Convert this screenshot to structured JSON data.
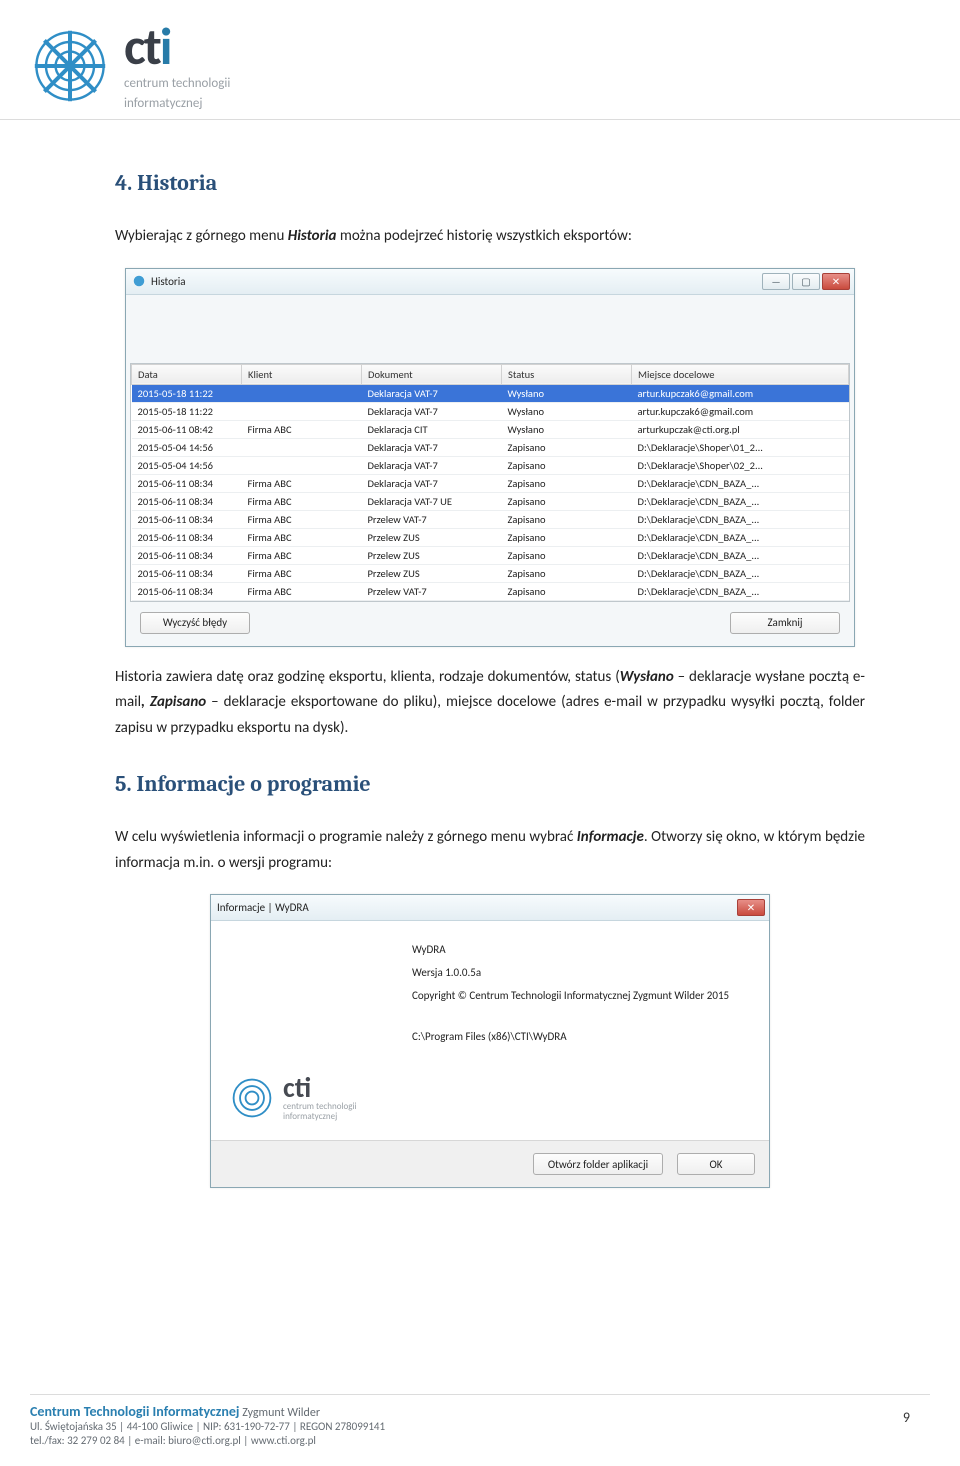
{
  "header": {
    "logo_sub1": "centrum technologii",
    "logo_sub2": "informatycznej"
  },
  "section1": {
    "title": "4. Historia",
    "intro_pre": "Wybierając z górnego menu ",
    "intro_em": "Historia",
    "intro_post": " można podejrzeć historię wszystkich eksportów:"
  },
  "historia_window": {
    "title": "Historia",
    "columns": [
      "Data",
      "Klient",
      "Dokument",
      "Status",
      "Miejsce docelowe"
    ],
    "rows": [
      {
        "data": "2015-05-18 11:22",
        "klient": "",
        "dokument": "Deklaracja VAT-7",
        "status": "Wysłano",
        "miejsce": "artur.kupczak6@gmail.com",
        "selected": true
      },
      {
        "data": "2015-05-18 11:22",
        "klient": "",
        "dokument": "Deklaracja VAT-7",
        "status": "Wysłano",
        "miejsce": "artur.kupczak6@gmail.com"
      },
      {
        "data": "2015-06-11 08:42",
        "klient": "Firma ABC",
        "dokument": "Deklaracja CIT",
        "status": "Wysłano",
        "miejsce": "arturkupczak@cti.org.pl"
      },
      {
        "data": "2015-05-04 14:56",
        "klient": "",
        "dokument": "Deklaracja VAT-7",
        "status": "Zapisano",
        "miejsce": "D:\\Deklaracje\\Shoper\\01_2..."
      },
      {
        "data": "2015-05-04 14:56",
        "klient": "",
        "dokument": "Deklaracja VAT-7",
        "status": "Zapisano",
        "miejsce": "D:\\Deklaracje\\Shoper\\02_2..."
      },
      {
        "data": "2015-06-11 08:34",
        "klient": "Firma ABC",
        "dokument": "Deklaracja VAT-7",
        "status": "Zapisano",
        "miejsce": "D:\\Deklaracje\\CDN_BAZA_..."
      },
      {
        "data": "2015-06-11 08:34",
        "klient": "Firma ABC",
        "dokument": "Deklaracja VAT-7 UE",
        "status": "Zapisano",
        "miejsce": "D:\\Deklaracje\\CDN_BAZA_..."
      },
      {
        "data": "2015-06-11 08:34",
        "klient": "Firma ABC",
        "dokument": "Przelew VAT-7",
        "status": "Zapisano",
        "miejsce": "D:\\Deklaracje\\CDN_BAZA_..."
      },
      {
        "data": "2015-06-11 08:34",
        "klient": "Firma ABC",
        "dokument": "Przelew ZUS",
        "status": "Zapisano",
        "miejsce": "D:\\Deklaracje\\CDN_BAZA_..."
      },
      {
        "data": "2015-06-11 08:34",
        "klient": "Firma ABC",
        "dokument": "Przelew ZUS",
        "status": "Zapisano",
        "miejsce": "D:\\Deklaracje\\CDN_BAZA_..."
      },
      {
        "data": "2015-06-11 08:34",
        "klient": "Firma ABC",
        "dokument": "Przelew ZUS",
        "status": "Zapisano",
        "miejsce": "D:\\Deklaracje\\CDN_BAZA_..."
      },
      {
        "data": "2015-06-11 08:34",
        "klient": "Firma ABC",
        "dokument": "Przelew VAT-7",
        "status": "Zapisano",
        "miejsce": "D:\\Deklaracje\\CDN_BAZA_..."
      }
    ],
    "btn_clear": "Wyczyść błędy",
    "btn_close": "Zamknij"
  },
  "para1": {
    "t1": "Historia zawiera datę oraz godzinę eksportu, klienta, rodzaje dokumentów, status (",
    "wys": "Wysłano",
    "t2": " – deklaracje wysłane pocztą e-mail",
    "sep": ", ",
    "zap": "Zapisano",
    "t3": " – deklaracje eksportowane do pliku), miejsce docelowe (adres e-mail w przypadku wysyłki pocztą, folder zapisu w przypadku eksportu na dysk)."
  },
  "section2": {
    "title": "5. Informacje o programie",
    "p_pre": "W celu wyświetlenia informacji o programie należy z górnego menu wybrać ",
    "p_em": "Informacje",
    "p_post": ". Otworzy się okno, w którym będzie informacja m.in. o wersji programu:"
  },
  "info_window": {
    "title": "Informacje | WyDRA",
    "app_name": "WyDRA",
    "version": "Wersja 1.0.0.5a",
    "copyright": "Copyright © Centrum Technologii Informatycznej Zygmunt Wilder 2015",
    "path": "C:\\Program Files (x86)\\CTI\\WyDRA",
    "logo_sub1": "centrum technologii",
    "logo_sub2": "informatycznej",
    "btn_open": "Otwórz folder aplikacji",
    "btn_ok": "OK"
  },
  "footer": {
    "company": "Centrum Technologii Informatycznej",
    "owner": " Zygmunt Wilder",
    "addr": "Ul. Świętojańska 35 | 44-100 Gliwice | NIP: 631-190-72-77 | REGON 278099141",
    "contact": "tel./fax: 32 279 02 84 | e-mail: biuro@cti.org.pl | www.cti.org.pl",
    "page": "9"
  }
}
